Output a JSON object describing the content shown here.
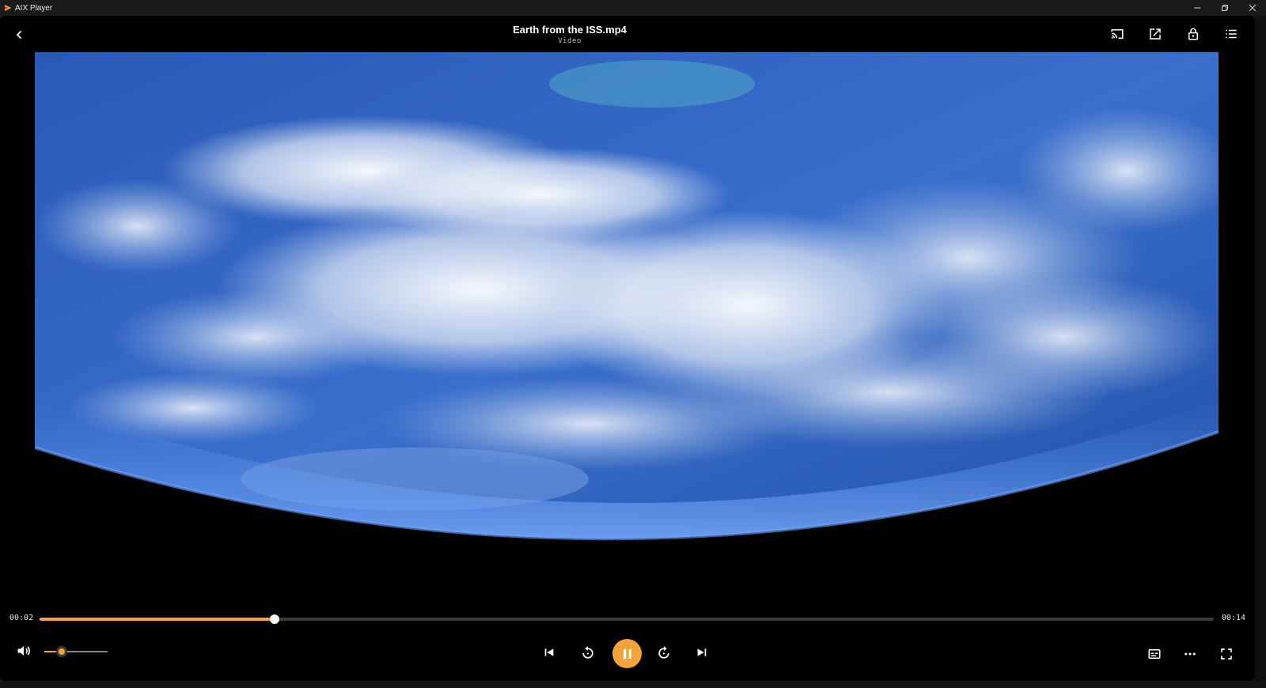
{
  "window": {
    "app_title": "AIX Player",
    "controls": [
      "minimize",
      "restore",
      "close"
    ]
  },
  "header": {
    "file_title": "Earth from the ISS.mp4",
    "file_type": "Video",
    "icons": [
      "cast-icon",
      "open-external-icon",
      "lock-icon",
      "playlist-icon"
    ]
  },
  "playback": {
    "current_time": "00:02",
    "total_time": "00:14",
    "progress_fraction": 0.2,
    "volume_fraction": 0.28,
    "state": "playing"
  },
  "colors": {
    "accent": "#f7a33b",
    "background": "#000000",
    "titlebar": "#1a1a1a"
  }
}
